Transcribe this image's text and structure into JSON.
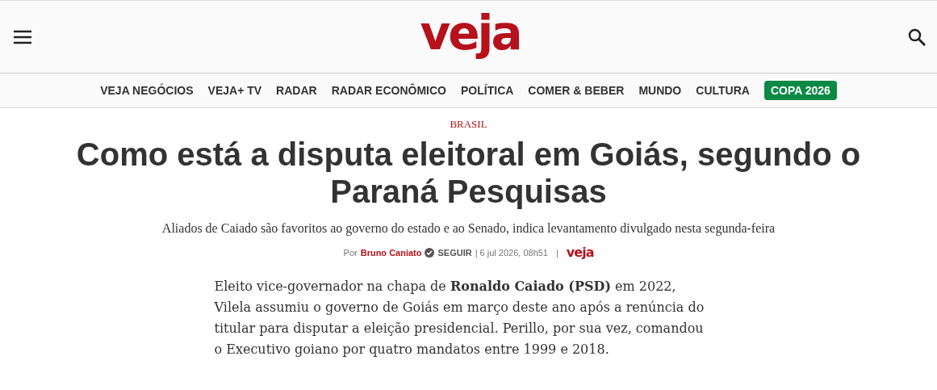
{
  "header": {
    "logo": "veja"
  },
  "nav": [
    {
      "label": "VEJA NEGÓCIOS",
      "kind": "link"
    },
    {
      "label": "VEJA+ TV",
      "kind": "link"
    },
    {
      "label": "RADAR",
      "kind": "link"
    },
    {
      "label": "RADAR ECONÔMICO",
      "kind": "link"
    },
    {
      "label": "POLÍTICA",
      "kind": "link"
    },
    {
      "label": "COMER & BEBER",
      "kind": "link"
    },
    {
      "label": "MUNDO",
      "kind": "link"
    },
    {
      "label": "CULTURA",
      "kind": "link"
    },
    {
      "label": "COPA 2026",
      "kind": "highlight"
    }
  ],
  "article": {
    "section": "BRASIL",
    "title": "Como está a disputa eleitoral em Goiás, segundo o Paraná Pesquisas",
    "subtitle": "Aliados de Caiado são favoritos ao governo do estado e ao Senado, indica levantamento divulgado nesta segunda-feira",
    "byline": {
      "prefix": "Por",
      "author": "Bruno Caniato",
      "follow": "SEGUIR",
      "date": "| 6 jul 2026, 08h51",
      "separator": "|",
      "brand": "veja"
    },
    "body": "Eleito vice-governador na chapa de **Ronaldo Caiado (PSD)** em 2022, Vilela assumiu o governo de Goiás em março deste ano após a renúncia do titular para disputar a eleição presidencial. Perillo, por sua vez, comandou o Executivo goiano por quatro mandatos entre 1999 e 2018."
  }
}
